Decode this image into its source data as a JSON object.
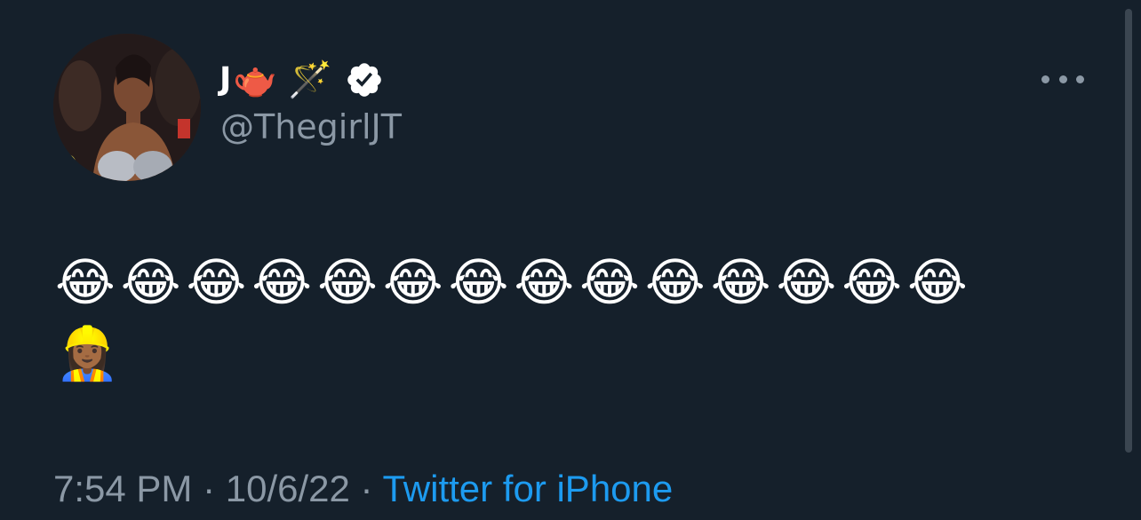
{
  "tweet": {
    "author": {
      "display_name": "J",
      "name_emoji_1": "🫖",
      "name_emoji_2": "🪄",
      "handle": "@ThegirlJT",
      "verified": true,
      "avatar_icon": "profile-photo"
    },
    "more_icon": "more-horizontal-icon",
    "text": "😂😂😂😂😂😂😂😂😂😂😂😂😂😂\n👷🏾‍♀️",
    "timestamp": "7:54 PM · 10/6/22 · ",
    "source": "Twitter for iPhone"
  },
  "colors": {
    "background": "#15202b",
    "primary_text": "#ffffff",
    "secondary_text": "#8b98a5",
    "link": "#1d9bf0"
  }
}
